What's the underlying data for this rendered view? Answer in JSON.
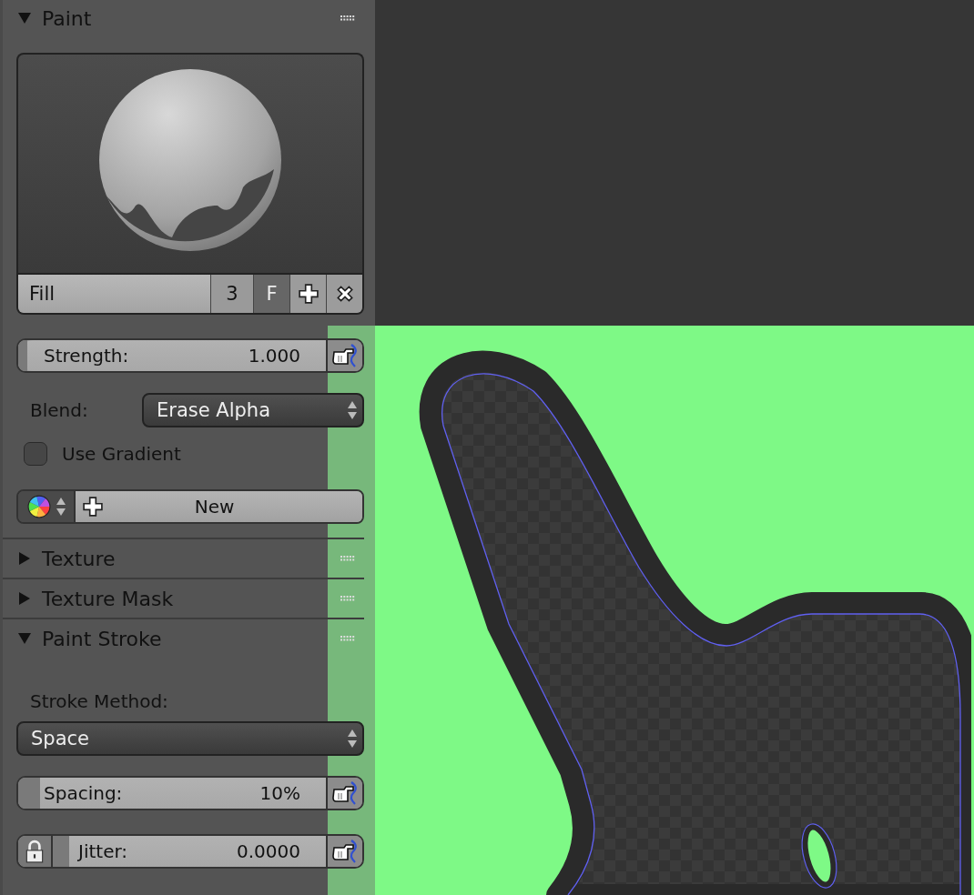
{
  "paint_panel": {
    "title": "Paint",
    "expanded": true,
    "brush": {
      "name": "Fill",
      "users": "3",
      "fake_user": "F"
    },
    "strength": {
      "label": "Strength:",
      "value": "1.000",
      "level": 0.03
    },
    "blend": {
      "label": "Blend:",
      "value": "Erase Alpha"
    },
    "use_gradient": {
      "label": "Use Gradient",
      "checked": false
    },
    "palette": {
      "button": "New"
    }
  },
  "collapsed_panels": [
    {
      "title": "Texture",
      "expanded": false
    },
    {
      "title": "Texture Mask",
      "expanded": false
    }
  ],
  "stroke_panel": {
    "title": "Paint Stroke",
    "expanded": true,
    "stroke_method": {
      "label": "Stroke Method:",
      "value": "Space"
    },
    "spacing": {
      "label": "Spacing:",
      "value": "10%",
      "level": 0.07
    },
    "jitter": {
      "label": "Jitter:",
      "value": "0.0000",
      "level": 0.06
    }
  }
}
